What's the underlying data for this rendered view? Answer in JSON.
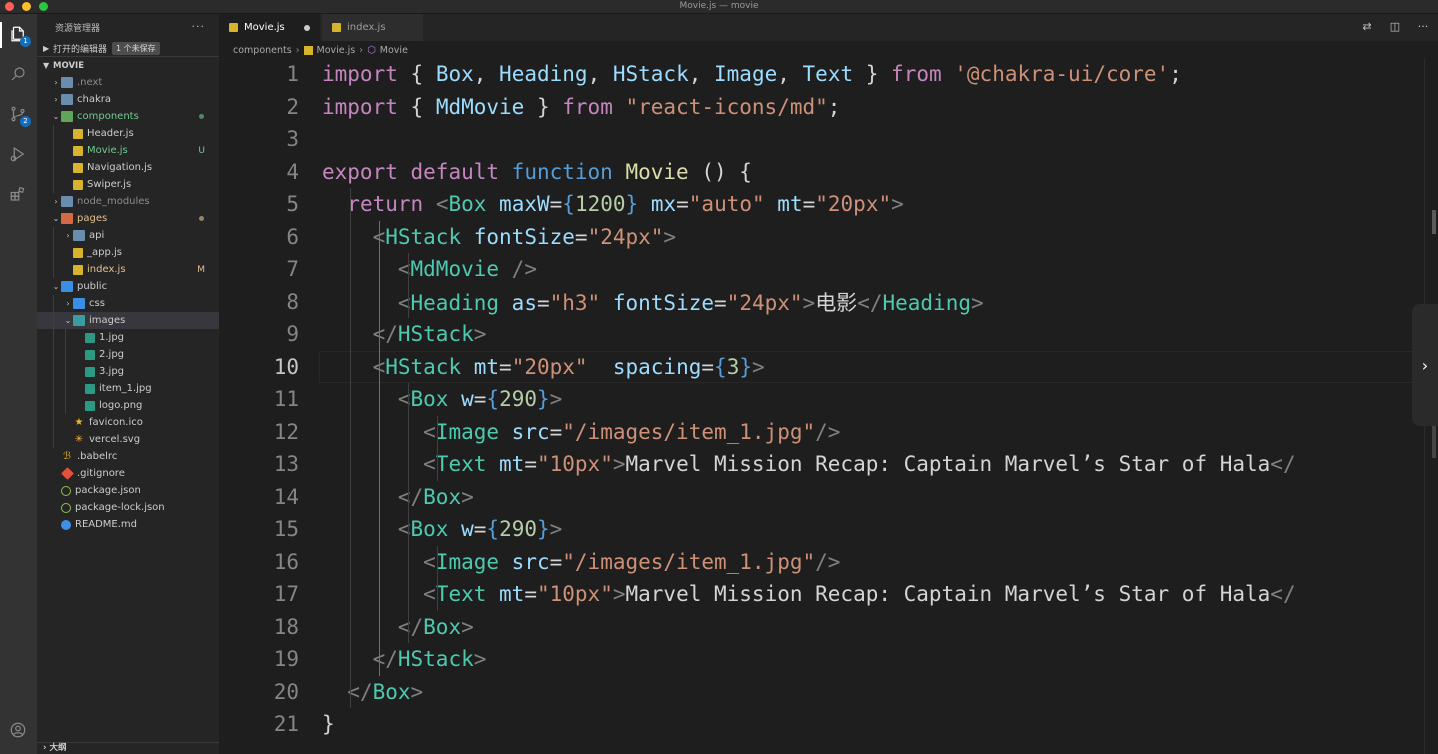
{
  "window": {
    "title": "Movie.js — movie"
  },
  "activity_bar": {
    "items": [
      {
        "name": "explorer-icon",
        "badge": "1"
      },
      {
        "name": "search-icon"
      },
      {
        "name": "source-control-icon",
        "badge": "2"
      },
      {
        "name": "run-debug-icon"
      },
      {
        "name": "extensions-icon"
      }
    ],
    "account_icon": "account-icon"
  },
  "sidebar": {
    "title": "资源管理器",
    "more": "···",
    "open_editors": {
      "label": "打开的编辑器",
      "badge": "1 个未保存"
    },
    "project": "MOVIE",
    "tree": [
      {
        "label": ".next",
        "depth": 1,
        "type": "folder",
        "open": false,
        "label_color": "dim"
      },
      {
        "label": "chakra",
        "depth": 1,
        "type": "folder",
        "open": false
      },
      {
        "label": "components",
        "depth": 1,
        "type": "folder-green",
        "open": true,
        "label_color": "green",
        "status": "dot-green"
      },
      {
        "label": "Header.js",
        "depth": 2,
        "type": "js"
      },
      {
        "label": "Movie.js",
        "depth": 2,
        "type": "js",
        "label_color": "green",
        "status": "U"
      },
      {
        "label": "Navigation.js",
        "depth": 2,
        "type": "js"
      },
      {
        "label": "Swiper.js",
        "depth": 2,
        "type": "js"
      },
      {
        "label": "node_modules",
        "depth": 1,
        "type": "folder",
        "open": false,
        "label_color": "dim"
      },
      {
        "label": "pages",
        "depth": 1,
        "type": "folder-red",
        "open": true,
        "label_color": "yellow",
        "status": "dot-yellow"
      },
      {
        "label": "api",
        "depth": 2,
        "type": "folder",
        "open": false
      },
      {
        "label": "_app.js",
        "depth": 2,
        "type": "js"
      },
      {
        "label": "index.js",
        "depth": 2,
        "type": "js",
        "label_color": "yellow",
        "status": "M"
      },
      {
        "label": "public",
        "depth": 1,
        "type": "folder-blue",
        "open": true
      },
      {
        "label": "css",
        "depth": 2,
        "type": "folder-blue",
        "open": false
      },
      {
        "label": "images",
        "depth": 2,
        "type": "folder-teal",
        "open": true,
        "selected": true
      },
      {
        "label": "1.jpg",
        "depth": 3,
        "type": "img"
      },
      {
        "label": "2.jpg",
        "depth": 3,
        "type": "img"
      },
      {
        "label": "3.jpg",
        "depth": 3,
        "type": "img"
      },
      {
        "label": "item_1.jpg",
        "depth": 3,
        "type": "img"
      },
      {
        "label": "logo.png",
        "depth": 3,
        "type": "img"
      },
      {
        "label": "favicon.ico",
        "depth": 2,
        "type": "star"
      },
      {
        "label": "vercel.svg",
        "depth": 2,
        "type": "svg"
      },
      {
        "label": ".babelrc",
        "depth": 1,
        "type": "babel"
      },
      {
        "label": ".gitignore",
        "depth": 1,
        "type": "git"
      },
      {
        "label": "package.json",
        "depth": 1,
        "type": "json"
      },
      {
        "label": "package-lock.json",
        "depth": 1,
        "type": "json"
      },
      {
        "label": "README.md",
        "depth": 1,
        "type": "info"
      }
    ],
    "outline": "大纲"
  },
  "tabs": [
    {
      "label": "Movie.js",
      "active": true,
      "dirty": true
    },
    {
      "label": "index.js",
      "active": false
    }
  ],
  "breadcrumb": [
    "components",
    "Movie.js",
    "Movie"
  ],
  "editor": {
    "current_line": 10,
    "lines": [
      [
        [
          "kw",
          "import "
        ],
        [
          "txt",
          "{ "
        ],
        [
          "attr",
          "Box"
        ],
        [
          "txt",
          ", "
        ],
        [
          "attr",
          "Heading"
        ],
        [
          "txt",
          ", "
        ],
        [
          "attr",
          "HStack"
        ],
        [
          "txt",
          ", "
        ],
        [
          "attr",
          "Image"
        ],
        [
          "txt",
          ", "
        ],
        [
          "attr",
          "Text"
        ],
        [
          "txt",
          " } "
        ],
        [
          "kw",
          "from "
        ],
        [
          "str",
          "'@chakra-ui/core'"
        ],
        [
          "txt",
          ";"
        ]
      ],
      [
        [
          "kw",
          "import "
        ],
        [
          "txt",
          "{ "
        ],
        [
          "attr",
          "MdMovie"
        ],
        [
          "txt",
          " } "
        ],
        [
          "kw",
          "from "
        ],
        [
          "str",
          "\"react-icons/md\""
        ],
        [
          "txt",
          ";"
        ]
      ],
      [],
      [
        [
          "kw",
          "export "
        ],
        [
          "kw",
          "default "
        ],
        [
          "kb",
          "function "
        ],
        [
          "fn",
          "Movie "
        ],
        [
          "txt",
          "() {"
        ]
      ],
      [
        [
          "txt",
          "  "
        ],
        [
          "kw",
          "return "
        ],
        [
          "pun",
          "<"
        ],
        [
          "tag",
          "Box "
        ],
        [
          "attr",
          "maxW"
        ],
        [
          "txt",
          "="
        ],
        [
          "kb",
          "{"
        ],
        [
          "num",
          "1200"
        ],
        [
          "kb",
          "}"
        ],
        [
          "txt",
          " "
        ],
        [
          "attr",
          "mx"
        ],
        [
          "txt",
          "="
        ],
        [
          "str",
          "\"auto\""
        ],
        [
          "txt",
          " "
        ],
        [
          "attr",
          "mt"
        ],
        [
          "txt",
          "="
        ],
        [
          "str",
          "\"20px\""
        ],
        [
          "pun",
          ">"
        ]
      ],
      [
        [
          "txt",
          "    "
        ],
        [
          "pun",
          "<"
        ],
        [
          "tag",
          "HStack "
        ],
        [
          "attr",
          "fontSize"
        ],
        [
          "txt",
          "="
        ],
        [
          "str",
          "\"24px\""
        ],
        [
          "pun",
          ">"
        ]
      ],
      [
        [
          "txt",
          "      "
        ],
        [
          "pun",
          "<"
        ],
        [
          "tag",
          "MdMovie "
        ],
        [
          "pun",
          "/>"
        ]
      ],
      [
        [
          "txt",
          "      "
        ],
        [
          "pun",
          "<"
        ],
        [
          "tag",
          "Heading "
        ],
        [
          "attr",
          "as"
        ],
        [
          "txt",
          "="
        ],
        [
          "str",
          "\"h3\""
        ],
        [
          "txt",
          " "
        ],
        [
          "attr",
          "fontSize"
        ],
        [
          "txt",
          "="
        ],
        [
          "str",
          "\"24px\""
        ],
        [
          "pun",
          ">"
        ],
        [
          "txt",
          "电影"
        ],
        [
          "pun",
          "</"
        ],
        [
          "tag",
          "Heading"
        ],
        [
          "pun",
          ">"
        ]
      ],
      [
        [
          "txt",
          "    "
        ],
        [
          "pun",
          "</"
        ],
        [
          "tag",
          "HStack"
        ],
        [
          "pun",
          ">"
        ]
      ],
      [
        [
          "txt",
          "    "
        ],
        [
          "pun",
          "<"
        ],
        [
          "tag",
          "HStack "
        ],
        [
          "attr",
          "mt"
        ],
        [
          "txt",
          "="
        ],
        [
          "str",
          "\"20px\""
        ],
        [
          "txt",
          "  "
        ],
        [
          "attr",
          "spacing"
        ],
        [
          "txt",
          "="
        ],
        [
          "kb",
          "{"
        ],
        [
          "num",
          "3"
        ],
        [
          "kb",
          "}"
        ],
        [
          "pun",
          ">"
        ]
      ],
      [
        [
          "txt",
          "      "
        ],
        [
          "pun",
          "<"
        ],
        [
          "tag",
          "Box "
        ],
        [
          "attr",
          "w"
        ],
        [
          "txt",
          "="
        ],
        [
          "kb",
          "{"
        ],
        [
          "num",
          "290"
        ],
        [
          "kb",
          "}"
        ],
        [
          "pun",
          ">"
        ]
      ],
      [
        [
          "txt",
          "        "
        ],
        [
          "pun",
          "<"
        ],
        [
          "tag",
          "Image "
        ],
        [
          "attr",
          "src"
        ],
        [
          "txt",
          "="
        ],
        [
          "str",
          "\"/images/item_1.jpg\""
        ],
        [
          "pun",
          "/>"
        ]
      ],
      [
        [
          "txt",
          "        "
        ],
        [
          "pun",
          "<"
        ],
        [
          "tag",
          "Text "
        ],
        [
          "attr",
          "mt"
        ],
        [
          "txt",
          "="
        ],
        [
          "str",
          "\"10px\""
        ],
        [
          "pun",
          ">"
        ],
        [
          "txt",
          "Marvel Mission Recap: Captain Marvel’s Star of Hala"
        ],
        [
          "pun",
          "</"
        ]
      ],
      [
        [
          "txt",
          "      "
        ],
        [
          "pun",
          "</"
        ],
        [
          "tag",
          "Box"
        ],
        [
          "pun",
          ">"
        ]
      ],
      [
        [
          "txt",
          "      "
        ],
        [
          "pun",
          "<"
        ],
        [
          "tag",
          "Box "
        ],
        [
          "attr",
          "w"
        ],
        [
          "txt",
          "="
        ],
        [
          "kb",
          "{"
        ],
        [
          "num",
          "290"
        ],
        [
          "kb",
          "}"
        ],
        [
          "pun",
          ">"
        ]
      ],
      [
        [
          "txt",
          "        "
        ],
        [
          "pun",
          "<"
        ],
        [
          "tag",
          "Image "
        ],
        [
          "attr",
          "src"
        ],
        [
          "txt",
          "="
        ],
        [
          "str",
          "\"/images/item_1.jpg\""
        ],
        [
          "pun",
          "/>"
        ]
      ],
      [
        [
          "txt",
          "        "
        ],
        [
          "pun",
          "<"
        ],
        [
          "tag",
          "Text "
        ],
        [
          "attr",
          "mt"
        ],
        [
          "txt",
          "="
        ],
        [
          "str",
          "\"10px\""
        ],
        [
          "pun",
          ">"
        ],
        [
          "txt",
          "Marvel Mission Recap: Captain Marvel’s Star of Hala"
        ],
        [
          "pun",
          "</"
        ]
      ],
      [
        [
          "txt",
          "      "
        ],
        [
          "pun",
          "</"
        ],
        [
          "tag",
          "Box"
        ],
        [
          "pun",
          ">"
        ]
      ],
      [
        [
          "txt",
          "    "
        ],
        [
          "pun",
          "</"
        ],
        [
          "tag",
          "HStack"
        ],
        [
          "pun",
          ">"
        ]
      ],
      [
        [
          "txt",
          "  "
        ],
        [
          "pun",
          "</"
        ],
        [
          "tag",
          "Box"
        ],
        [
          "pun",
          ">"
        ]
      ],
      [
        [
          "txt",
          "}"
        ]
      ]
    ]
  },
  "colors": {
    "keyword": "#c586c0",
    "function_keyword": "#569cd6",
    "function_name": "#dcdcaa",
    "string": "#ce9178",
    "tag": "#4ec9b0",
    "attribute": "#9cdcfe",
    "number": "#b5cea8",
    "editor_bg": "#1e1e1e",
    "sidebar_bg": "#252526",
    "activity_bg": "#333333"
  }
}
